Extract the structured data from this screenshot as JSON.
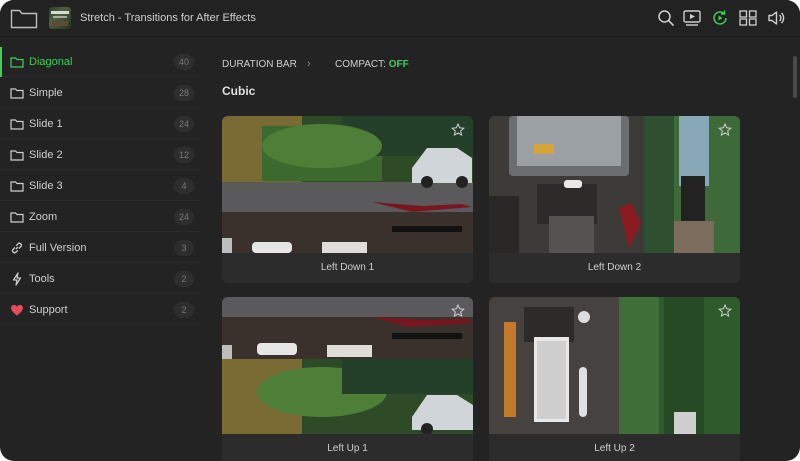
{
  "header": {
    "title": "Stretch - Transitions for After Effects",
    "icons": [
      "folder-icon",
      "search-icon",
      "preview-icon",
      "auto-refresh-icon",
      "grid-view-icon",
      "volume-icon"
    ],
    "accent": "#3ecf5b"
  },
  "sidebar": {
    "items": [
      {
        "label": "Diagonal",
        "count": "40",
        "icon": "folder-icon",
        "active": true
      },
      {
        "label": "Simple",
        "count": "28",
        "icon": "folder-icon"
      },
      {
        "label": "Slide 1",
        "count": "24",
        "icon": "folder-icon"
      },
      {
        "label": "Slide 2",
        "count": "12",
        "icon": "folder-icon"
      },
      {
        "label": "Slide 3",
        "count": "4",
        "icon": "folder-icon"
      },
      {
        "label": "Zoom",
        "count": "24",
        "icon": "folder-icon"
      },
      {
        "label": "Full Version",
        "count": "3",
        "icon": "link-icon"
      },
      {
        "label": "Tools",
        "count": "2",
        "icon": "lightning-icon"
      },
      {
        "label": "Support",
        "count": "2",
        "icon": "heart-icon"
      }
    ]
  },
  "toolbar": {
    "duration_bar": "DURATION BAR",
    "compact_label": "COMPACT:",
    "compact_value": "OFF"
  },
  "section": {
    "title": "Cubic"
  },
  "cards": [
    {
      "label": "Left Down 1"
    },
    {
      "label": "Left Down 2"
    },
    {
      "label": "Left Up 1"
    },
    {
      "label": "Left Up 2"
    }
  ]
}
